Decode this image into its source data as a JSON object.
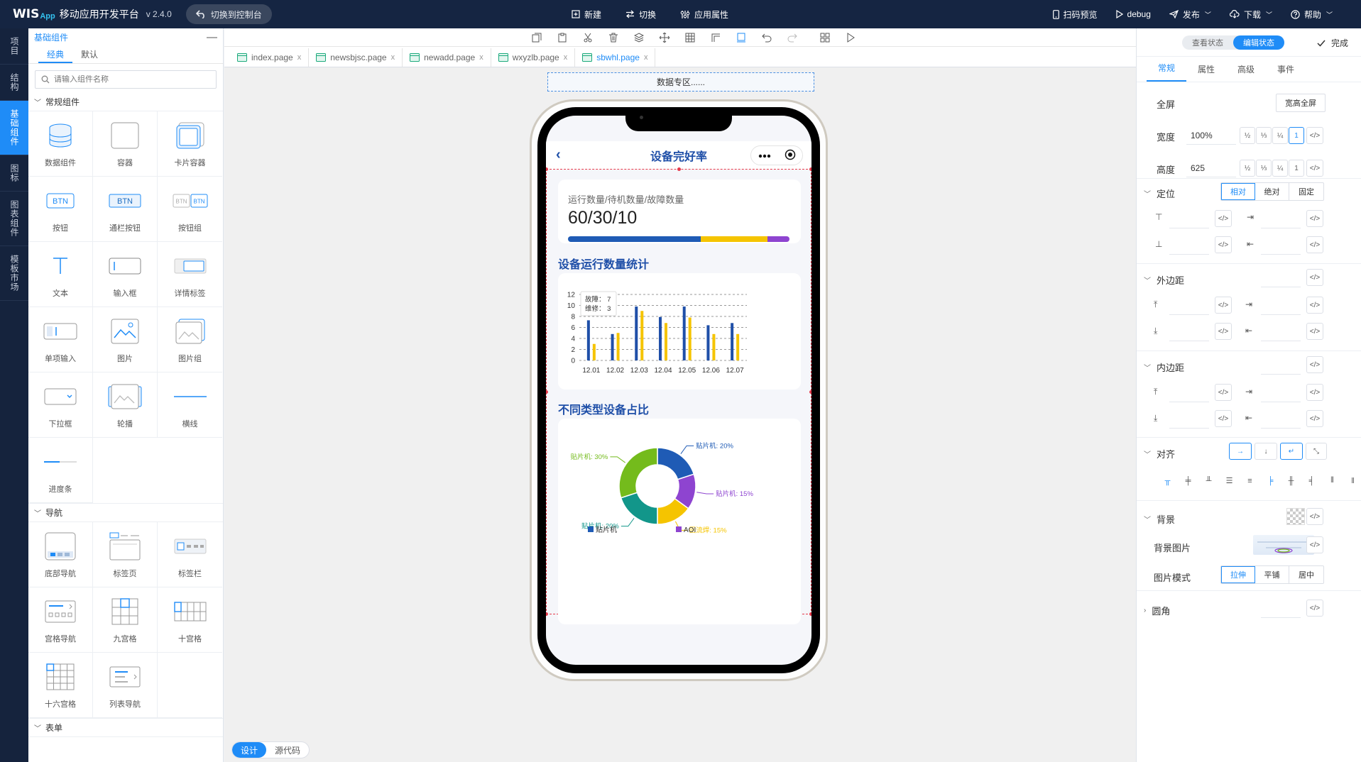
{
  "topbar": {
    "logo": "WIS",
    "logo_sub": "App",
    "title": "移动应用开发平台",
    "version": "v 2.4.0",
    "switch_console": "切换到控制台",
    "center": [
      {
        "icon": "new-file-icon",
        "label": "新建"
      },
      {
        "icon": "swap-icon",
        "label": "切换"
      },
      {
        "icon": "sliders-icon",
        "label": "应用属性"
      }
    ],
    "right": [
      {
        "icon": "phone-icon",
        "label": "扫码预览"
      },
      {
        "icon": "play-icon",
        "label": "debug"
      },
      {
        "icon": "send-icon",
        "label": "发布"
      },
      {
        "icon": "cloud-download-icon",
        "label": "下载"
      },
      {
        "icon": "help-icon",
        "label": "帮助"
      }
    ]
  },
  "leftnav": [
    {
      "label": "项目",
      "active": false
    },
    {
      "label": "结构",
      "active": false
    },
    {
      "label": "基础组件",
      "active": true
    },
    {
      "label": "图标",
      "active": false
    },
    {
      "label": "图表组件",
      "active": false
    },
    {
      "label": "模板市场",
      "active": false
    }
  ],
  "complib": {
    "title": "基础组件",
    "tabs": [
      "经典",
      "默认"
    ],
    "search_placeholder": "请输入组件名称",
    "groups": [
      {
        "name": "常规组件",
        "items": [
          "数据组件",
          "容器",
          "卡片容器",
          "按钮",
          "通栏按钮",
          "按钮组",
          "文本",
          "输入框",
          "详情标签",
          "单项输入",
          "图片",
          "图片组",
          "下拉框",
          "轮播",
          "横线",
          "进度条"
        ]
      },
      {
        "name": "导航",
        "items": [
          "底部导航",
          "标签页",
          "标签栏",
          "宫格导航",
          "九宫格",
          "十宫格",
          "十六宫格",
          "列表导航"
        ]
      },
      {
        "name": "表单",
        "items": []
      }
    ],
    "btn_text": "BTN"
  },
  "filetabs": [
    {
      "label": "index.page",
      "active": false
    },
    {
      "label": "newsbjsc.page",
      "active": false
    },
    {
      "label": "newadd.page",
      "active": false
    },
    {
      "label": "wxyzlb.page",
      "active": false
    },
    {
      "label": "sbwhl.page",
      "active": true
    }
  ],
  "canvas": {
    "zone": "数据专区......",
    "page_title": "设备完好率",
    "stat_label": "运行数量/待机数量/故障数量",
    "stat_value": "60/30/10",
    "stat_split": [
      60,
      30,
      10
    ],
    "section_bar": "设备运行数量统计",
    "section_pie": "不同类型设备占比",
    "modes": [
      "设计",
      "源代码"
    ]
  },
  "chart_data": [
    {
      "type": "bar",
      "categories": [
        "12.01",
        "12.02",
        "12.03",
        "12.04",
        "12.05",
        "12.06",
        "12.07"
      ],
      "series": [
        {
          "name": "故障",
          "values": [
            7.3,
            4.8,
            9.8,
            7.9,
            9.8,
            6.4,
            6.8
          ],
          "color": "#1f4fa8"
        },
        {
          "name": "维修",
          "values": [
            3,
            5,
            9,
            6.8,
            7.8,
            4.8,
            4.8
          ],
          "color": "#f5c400"
        }
      ],
      "yticks": [
        0,
        2,
        4,
        6,
        8,
        10,
        12
      ],
      "ylim": [
        0,
        12
      ],
      "tooltip": {
        "lines": [
          {
            "label": "故障",
            "value": "7"
          },
          {
            "label": "维修",
            "value": "3"
          }
        ]
      },
      "grid": true
    },
    {
      "type": "pie",
      "donut": true,
      "slices": [
        {
          "label": "贴片机: 20%",
          "value": 20,
          "color": "#1f5bb5"
        },
        {
          "label": "贴片机: 15%",
          "value": 15,
          "color": "#8e44d0"
        },
        {
          "label": "回流焊: 15%",
          "value": 15,
          "color": "#f5c400"
        },
        {
          "label": "贴片机: 20%",
          "value": 20,
          "color": "#12968a"
        },
        {
          "label": "贴片机: 30%",
          "value": 30,
          "color": "#74bb1c"
        }
      ],
      "legend": [
        {
          "label": "贴片机",
          "color": "#1f5bb5"
        },
        {
          "label": "AOI",
          "color": "#8e44d0"
        }
      ]
    }
  ],
  "props": {
    "states": [
      "查看状态",
      "编辑状态"
    ],
    "done": "完成",
    "tabs": [
      "常规",
      "属性",
      "高级",
      "事件"
    ],
    "fullscreen_label": "全屏",
    "fullscreen_btn": "宽高全屏",
    "width_label": "宽度",
    "width_value": "100%",
    "height_label": "高度",
    "height_value": "625",
    "fractions": [
      "½",
      "⅓",
      "¼",
      "1"
    ],
    "code": "</>",
    "position_label": "定位",
    "position_options": [
      "相对",
      "绝对",
      "固定"
    ],
    "margin_label": "外边距",
    "padding_label": "内边距",
    "align_label": "对齐",
    "bg_label": "背景",
    "bg_image_label": "背景图片",
    "image_mode_label": "图片模式",
    "image_modes": [
      "拉伸",
      "平铺",
      "居中"
    ],
    "radius_label": "圆角"
  }
}
